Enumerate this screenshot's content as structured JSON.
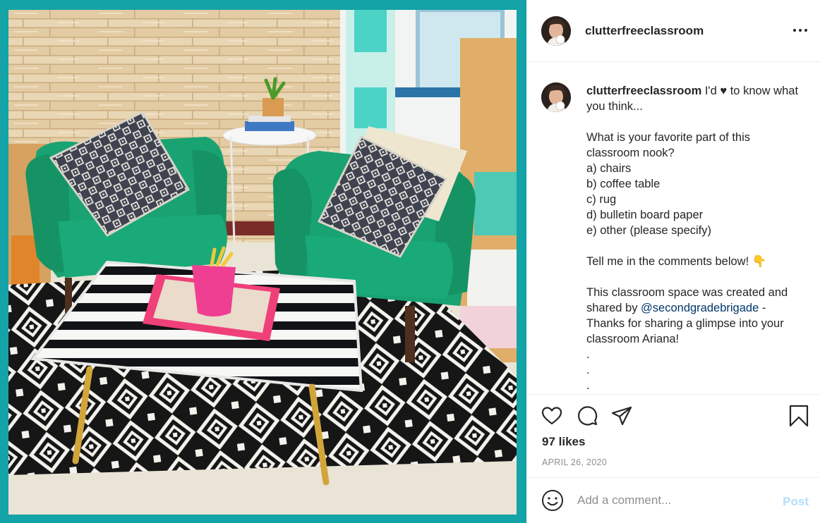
{
  "post": {
    "username": "clutterfreeclassroom",
    "more_label": "More options",
    "photo_alt": "Classroom reading nook with two green armchairs, a striped coffee table and a black and white rug",
    "caption": {
      "username": "clutterfreeclassroom",
      "line1_a": " I'd ",
      "heart_char": "♥",
      "line1_b": " to know what you think...",
      "question": "What is your favorite part of this classroom nook?",
      "options": [
        "a) chairs",
        "b) coffee table",
        "c) rug",
        "d) bulletin board paper",
        "e) other (please specify)"
      ],
      "cta_text": "Tell me in the comments below! ",
      "cta_emoji": "👇",
      "shared_a": "This classroom space was created and shared by ",
      "mention": "@secondgradebrigade",
      "shared_b": " - Thanks for sharing a glimpse into your classroom Ariana!",
      "dots": [
        ".",
        ".",
        "."
      ]
    },
    "likes": "97 likes",
    "date": "APRIL 26, 2020"
  },
  "comment": {
    "placeholder": "Add a comment...",
    "post_label": "Post"
  },
  "icons": {
    "like": "heart-icon",
    "comment": "comment-icon",
    "share": "paper-plane-icon",
    "save": "bookmark-icon",
    "emoji": "emoji-icon",
    "more": "more-dots-icon"
  },
  "colors": {
    "frame": "#14a3a6",
    "mention": "#00376b",
    "post_disabled": "#b2dffc",
    "muted": "#8e8e8e"
  }
}
